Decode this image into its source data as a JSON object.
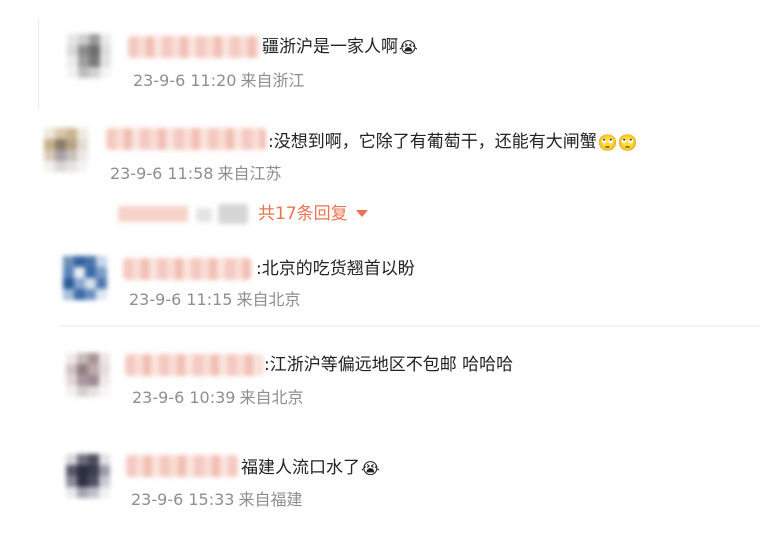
{
  "comments": [
    {
      "text": "疆浙沪是一家人啊",
      "emoji": "😭",
      "time": "23-9-6 11:20",
      "location": "来自浙江"
    },
    {
      "text": ":没想到啊，它除了有葡萄干，还能有大闸蟹",
      "emoji": "🙄🙄",
      "time": "23-9-6 11:58",
      "location": "来自江苏"
    }
  ],
  "reply_toggle": "共17条回复",
  "replies": [
    {
      "text": ":北京的吃货翘首以盼",
      "emoji": "",
      "time": "23-9-6 11:15",
      "location": "来自北京"
    },
    {
      "text": ":江浙沪等偏远地区不包邮 哈哈哈",
      "emoji": "",
      "time": "23-9-6 10:39",
      "location": "来自北京"
    },
    {
      "text": "福建人流口水了",
      "emoji": "😭",
      "time": "23-9-6 15:33",
      "location": "来自福建"
    }
  ],
  "colors": {
    "reply_link": "#eb7350",
    "meta": "#8e8e8e",
    "text": "#222222"
  }
}
